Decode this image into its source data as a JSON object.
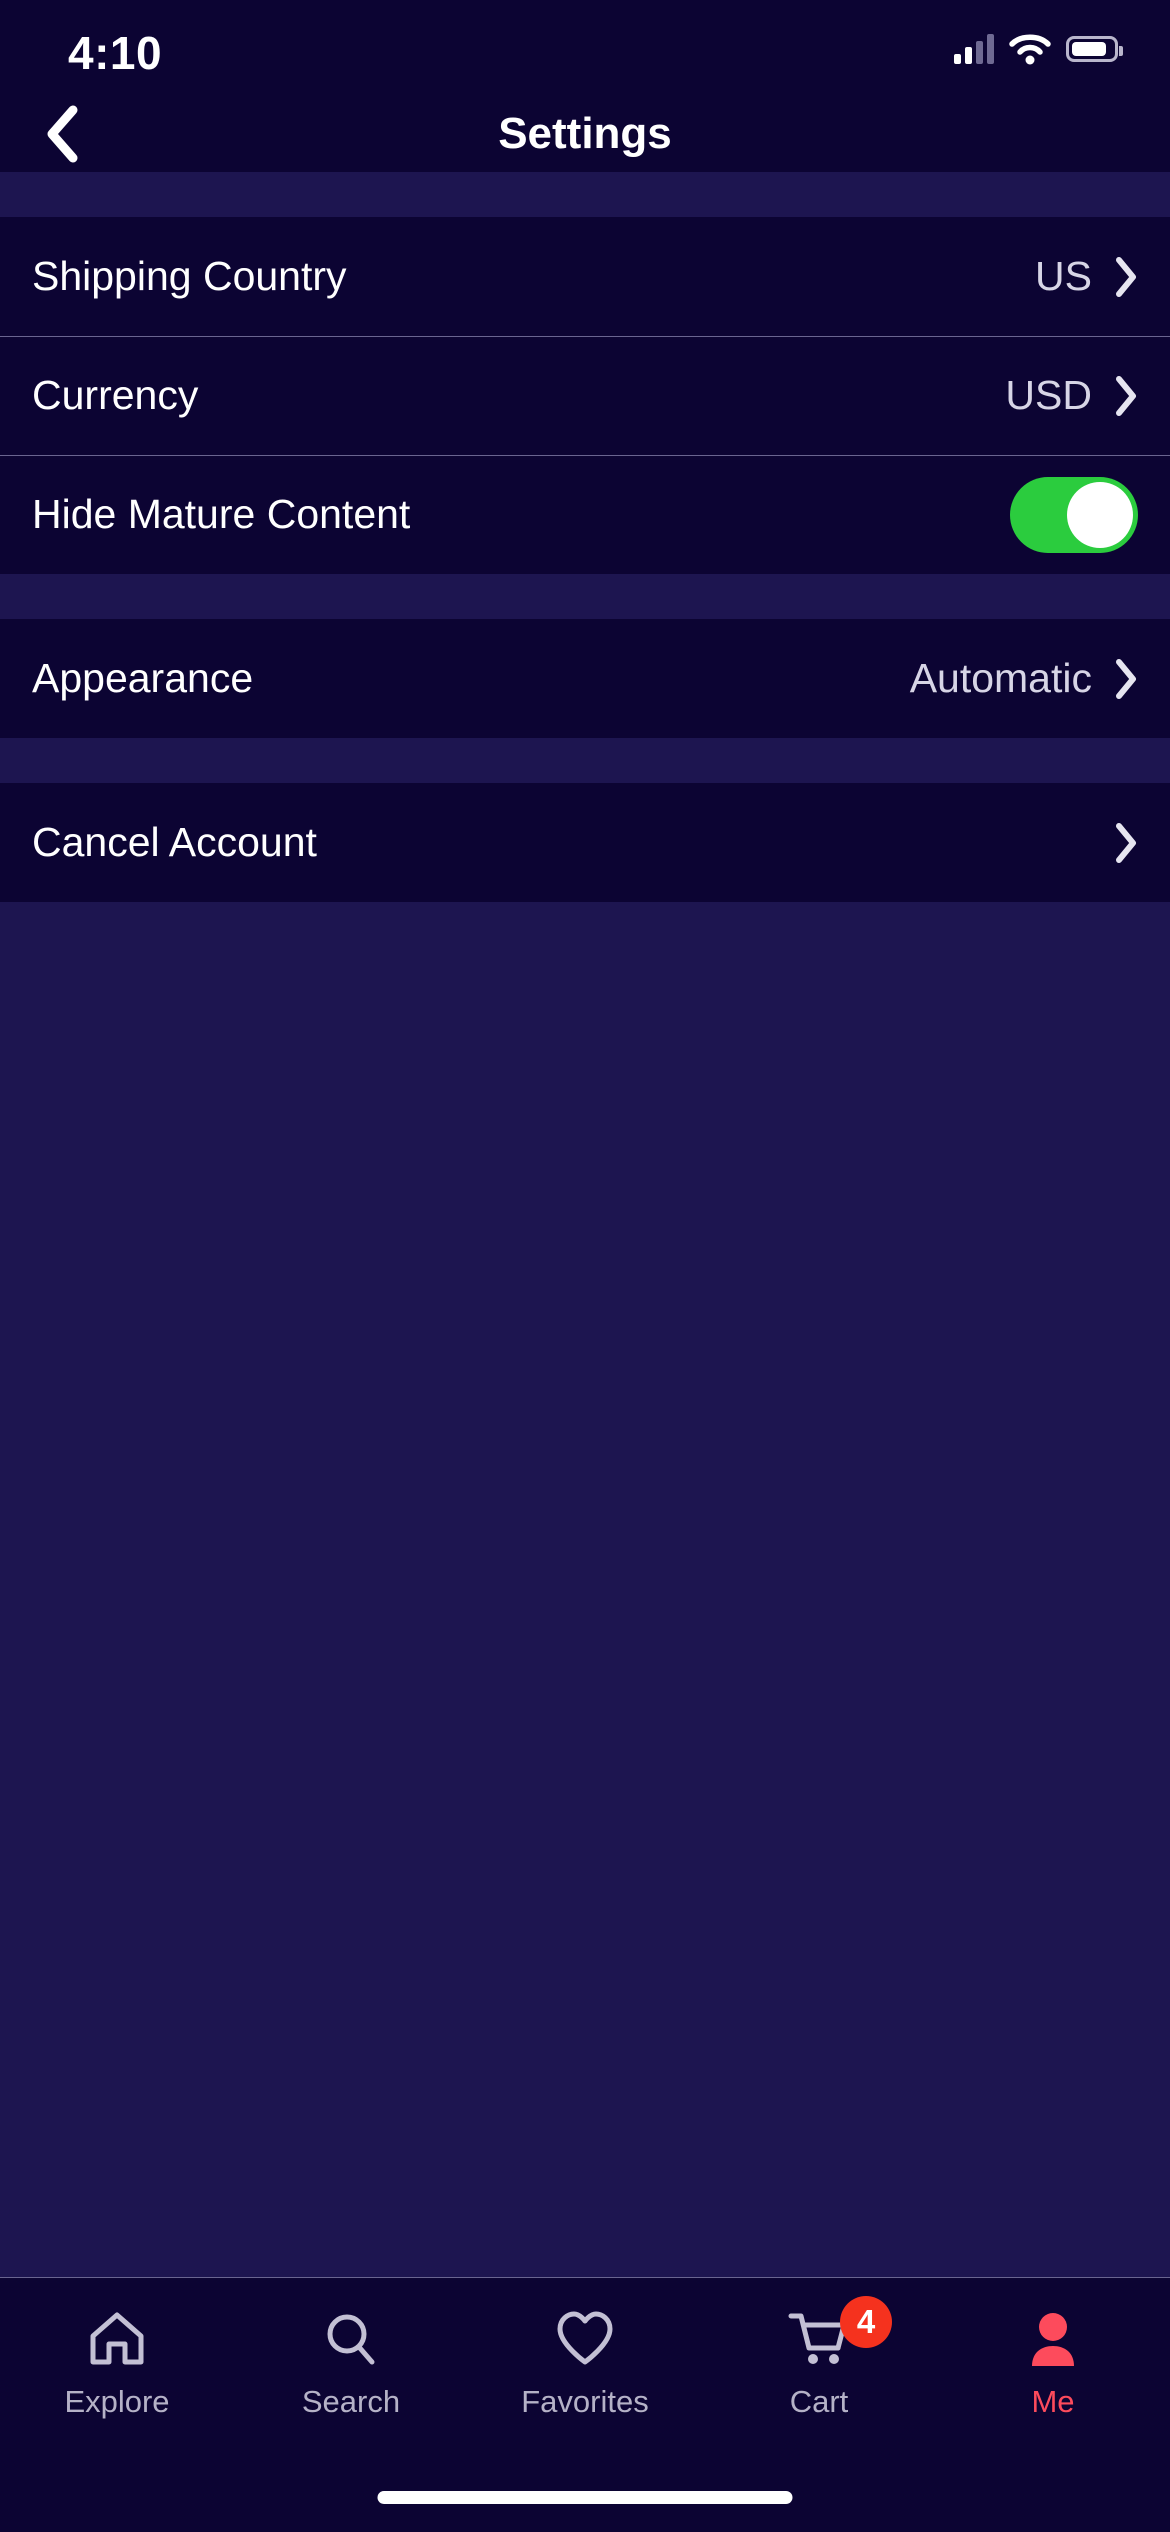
{
  "status_bar": {
    "time": "4:10",
    "signal_icon": "cellular-signal-icon",
    "wifi_icon": "wifi-icon",
    "battery_icon": "battery-icon"
  },
  "header": {
    "back_icon": "back-chevron-icon",
    "title": "Settings"
  },
  "sections": [
    {
      "rows": [
        {
          "label": "Shipping Country",
          "value": "US",
          "type": "disclosure"
        },
        {
          "label": "Currency",
          "value": "USD",
          "type": "disclosure"
        },
        {
          "label": "Hide Mature Content",
          "value": "",
          "type": "toggle",
          "toggle_on": true
        }
      ]
    },
    {
      "rows": [
        {
          "label": "Appearance",
          "value": "Automatic",
          "type": "disclosure"
        }
      ]
    },
    {
      "rows": [
        {
          "label": "Cancel Account",
          "value": "",
          "type": "disclosure"
        }
      ]
    }
  ],
  "tab_bar": {
    "items": [
      {
        "label": "Explore",
        "icon": "home-icon",
        "active": false,
        "badge": ""
      },
      {
        "label": "Search",
        "icon": "search-icon",
        "active": false,
        "badge": ""
      },
      {
        "label": "Favorites",
        "icon": "heart-icon",
        "active": false,
        "badge": ""
      },
      {
        "label": "Cart",
        "icon": "cart-icon",
        "active": false,
        "badge": "4"
      },
      {
        "label": "Me",
        "icon": "person-icon",
        "active": true,
        "badge": ""
      }
    ]
  },
  "colors": {
    "row_background": "#0c0433",
    "section_background": "#1d1550",
    "toggle_on": "#2bcc3e",
    "badge": "#f5321e",
    "active_tab": "#fd4b5c",
    "text_primary": "#ffffff",
    "text_secondary": "#b5b2c7"
  }
}
